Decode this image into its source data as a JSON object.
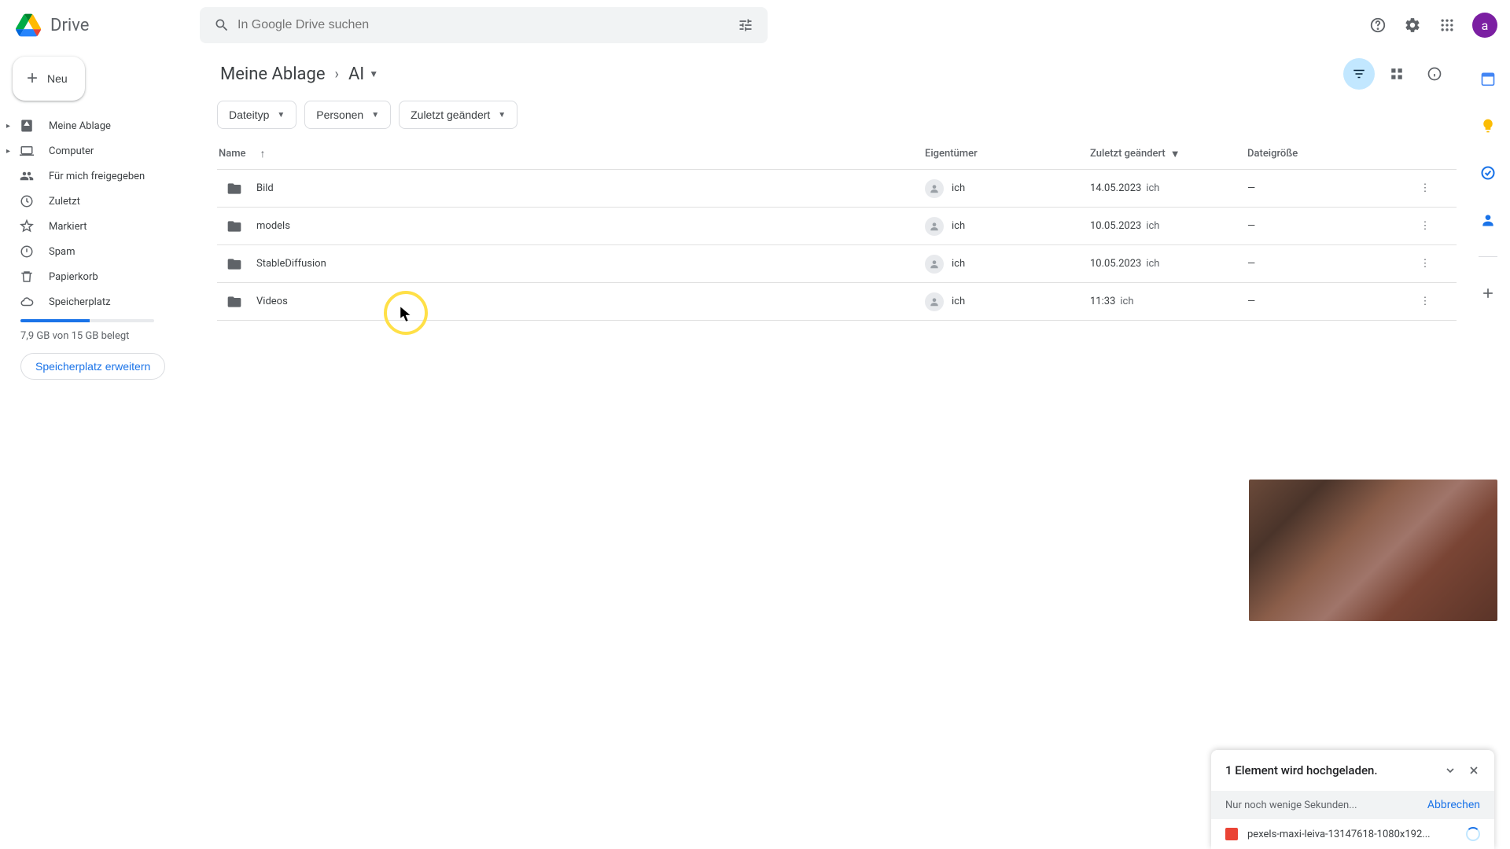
{
  "app": {
    "name": "Drive",
    "avatar_letter": "a"
  },
  "search": {
    "placeholder": "In Google Drive suchen"
  },
  "new_button": {
    "label": "Neu"
  },
  "sidebar": {
    "items": [
      {
        "label": "Meine Ablage"
      },
      {
        "label": "Computer"
      },
      {
        "label": "Für mich freigegeben"
      },
      {
        "label": "Zuletzt"
      },
      {
        "label": "Markiert"
      },
      {
        "label": "Spam"
      },
      {
        "label": "Papierkorb"
      },
      {
        "label": "Speicherplatz"
      }
    ],
    "storage_text": "7,9 GB von 15 GB belegt",
    "buy_label": "Speicherplatz erweitern"
  },
  "breadcrumb": {
    "root": "Meine Ablage",
    "current": "AI"
  },
  "filters": [
    {
      "label": "Dateityp"
    },
    {
      "label": "Personen"
    },
    {
      "label": "Zuletzt geändert"
    }
  ],
  "columns": {
    "name": "Name",
    "owner": "Eigentümer",
    "modified": "Zuletzt geändert",
    "size": "Dateigröße"
  },
  "owner_me": "ich",
  "rows": [
    {
      "name": "Bild",
      "owner": "ich",
      "date": "14.05.2023",
      "by": "ich",
      "size": "—"
    },
    {
      "name": "models",
      "owner": "ich",
      "date": "10.05.2023",
      "by": "ich",
      "size": "—"
    },
    {
      "name": "StableDiffusion",
      "owner": "ich",
      "date": "10.05.2023",
      "by": "ich",
      "size": "—"
    },
    {
      "name": "Videos",
      "owner": "ich",
      "date": "11:33",
      "by": "ich",
      "size": "—"
    }
  ],
  "upload": {
    "title": "1 Element wird hochgeladen.",
    "subtitle": "Nur noch wenige Sekunden...",
    "cancel": "Abbrechen",
    "file": "pexels-maxi-leiva-13147618-1080x192..."
  }
}
